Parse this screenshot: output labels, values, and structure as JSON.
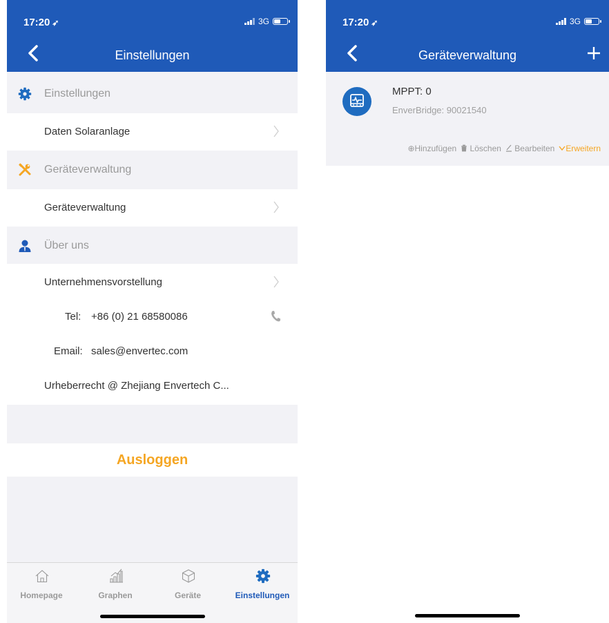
{
  "colors": {
    "primary": "#1f5ab8",
    "accent": "#f5a623",
    "muted": "#9a9a9a"
  },
  "left": {
    "status": {
      "time": "17:20",
      "network": "3G"
    },
    "nav": {
      "title": "Einstellungen",
      "back_icon": "chevron-left-icon"
    },
    "sections": [
      {
        "icon": "gear-icon",
        "header": "Einstellungen",
        "rows": [
          {
            "label": "Daten Solaranlage"
          }
        ]
      },
      {
        "icon": "tools-icon",
        "header": "Geräteverwaltung",
        "rows": [
          {
            "label": "Geräteverwaltung"
          }
        ]
      },
      {
        "icon": "user-icon",
        "header": "Über uns"
      }
    ],
    "about": {
      "company": "Unternehmensvorstellung",
      "tel_label": "Tel:",
      "tel_value": "+86 (0) 21 68580086",
      "email_label": "Email:",
      "email_value": "sales@envertec.com",
      "copyright": "Urheberrecht @  Zhejiang Envertech C..."
    },
    "logout": "Ausloggen",
    "tabs": [
      {
        "label": "Homepage",
        "icon": "home-icon"
      },
      {
        "label": "Graphen",
        "icon": "chart-icon"
      },
      {
        "label": "Geräte",
        "icon": "box-icon"
      },
      {
        "label": "Einstellungen",
        "icon": "gear-icon",
        "active": true
      }
    ]
  },
  "right": {
    "status": {
      "time": "17:20",
      "network": "3G"
    },
    "nav": {
      "title": "Geräteverwaltung"
    },
    "device": {
      "name": "MPPT: 0",
      "bridge": "EnverBridge: 90021540"
    },
    "actions": {
      "add": "⊕Hinzufügen",
      "delete": "Löschen",
      "edit": "Bearbeiten",
      "expand": "Erweitern"
    }
  }
}
